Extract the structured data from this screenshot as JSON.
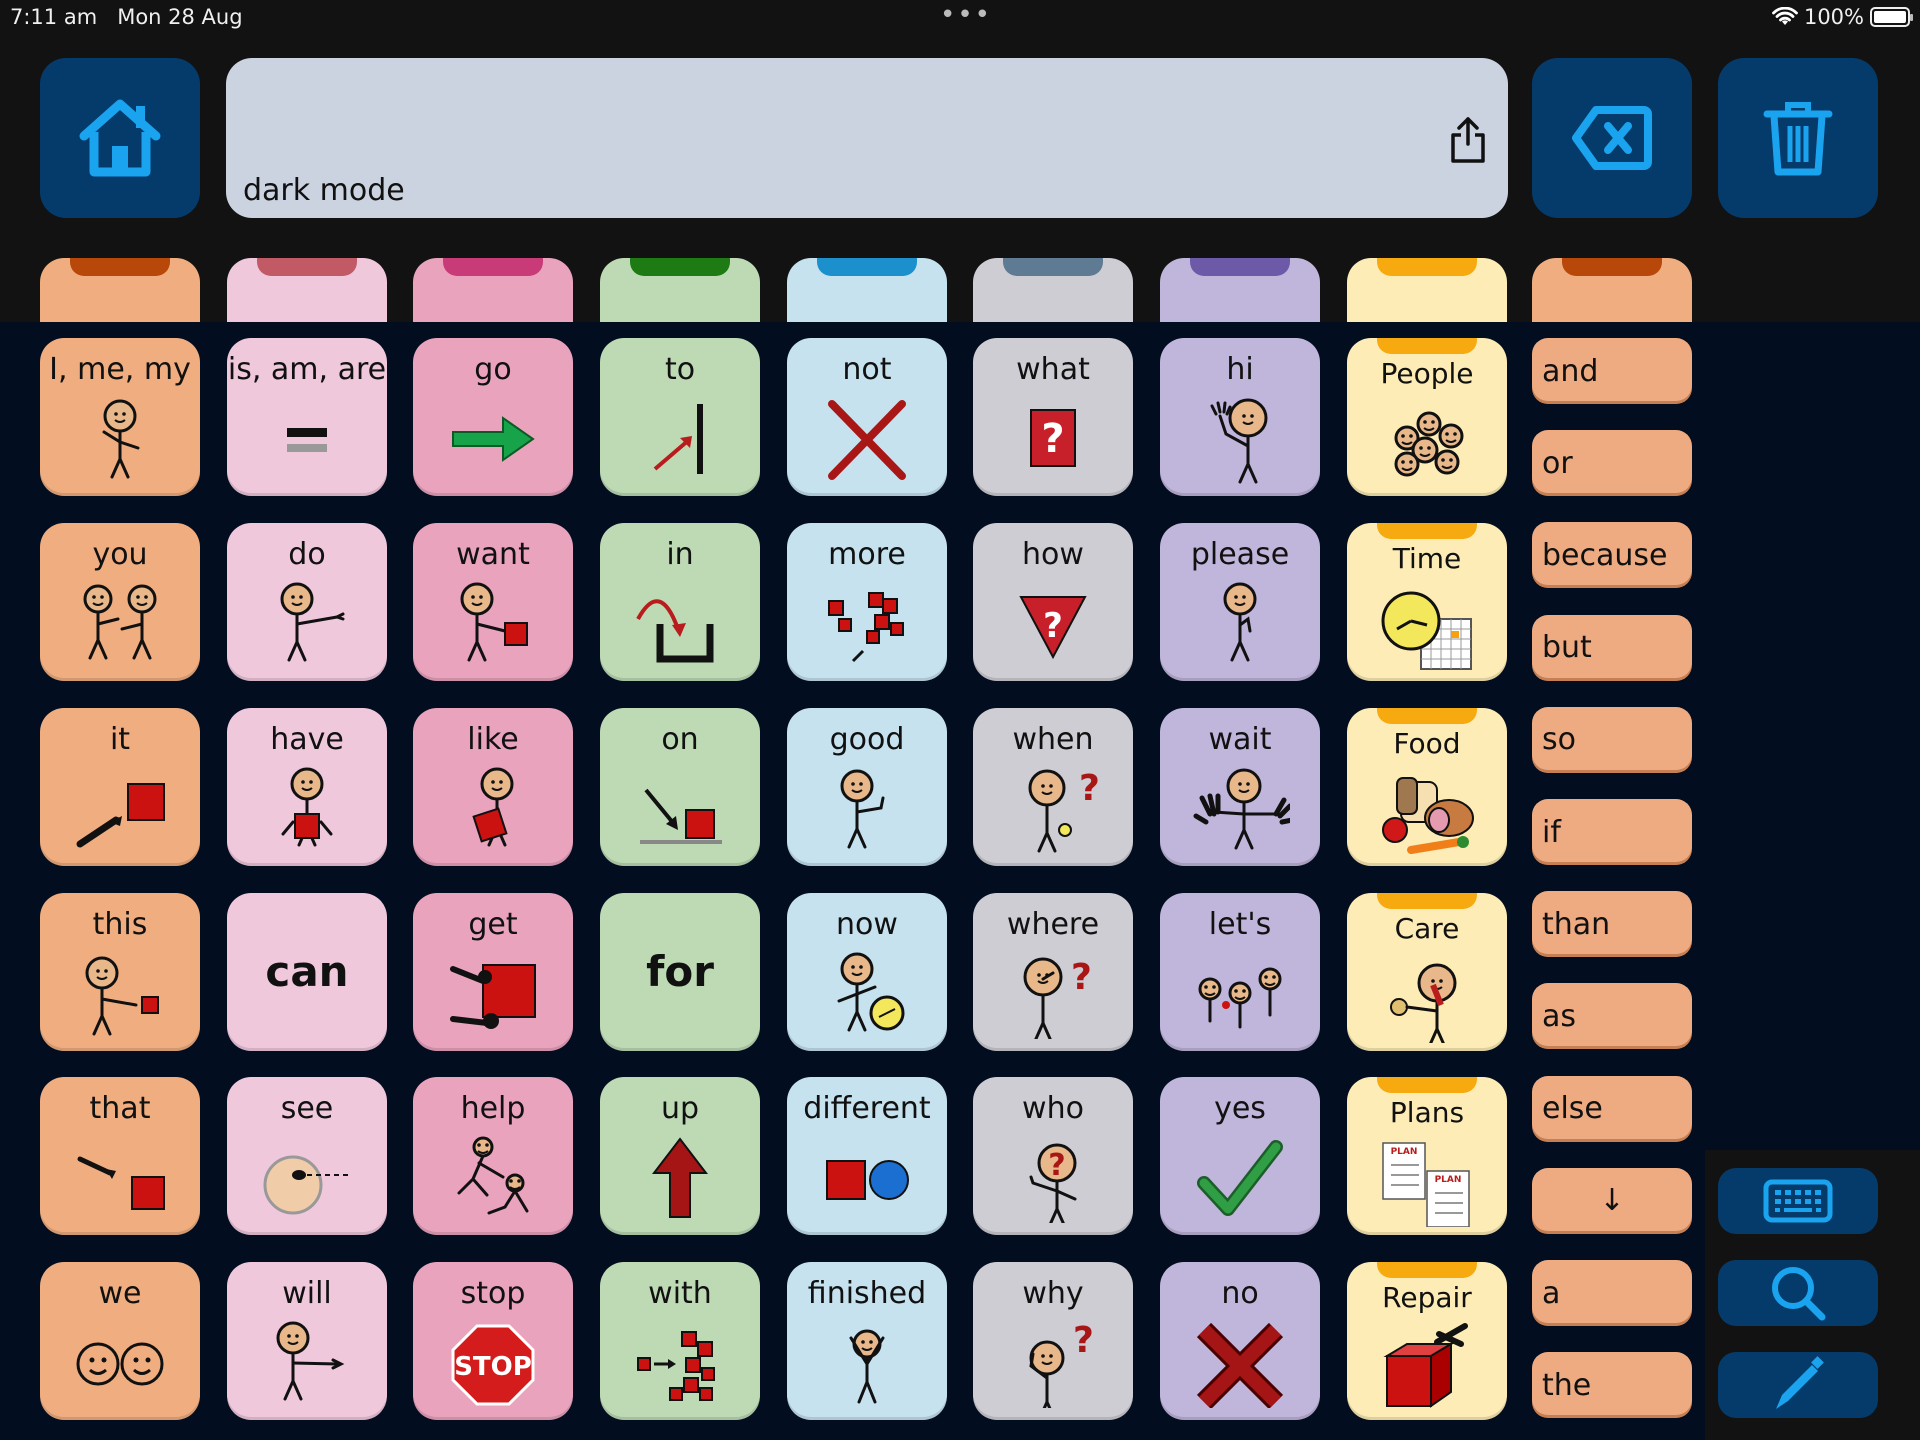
{
  "status_bar": {
    "time": "7:11 am",
    "date": "Mon 28 Aug",
    "battery_percent": "100%",
    "battery_level": 1.0
  },
  "toolbar": {
    "home_icon": "home-icon",
    "message_text": "dark mode",
    "share_icon": "share-icon",
    "backspace_icon": "backspace-icon",
    "clear_icon": "trash-icon"
  },
  "colors": {
    "accent_icon": "#1aa3ef",
    "toolbar_button": "#053b6b",
    "grid_background": "#020d1f",
    "orange": "#efad80",
    "orange_notch": "#b8470a",
    "pink_light": "#f0c8dc",
    "pink_light_notch": "#c25a66",
    "pink": "#e9a3bd",
    "pink_notch": "#c93b78",
    "green": "#bddab4",
    "green_notch": "#1e7a12",
    "blue": "#c5e2ee",
    "blue_notch": "#1b90cc",
    "gray": "#cdcdd3",
    "gray_notch": "#5f7a93",
    "purple": "#c0b5da",
    "purple_notch": "#6c5aa8",
    "yellow": "#fdecb6",
    "yellow_notch": "#f7aa0f"
  },
  "tabs": [
    "orange",
    "pink_light",
    "pink",
    "green",
    "blue",
    "gray",
    "purple",
    "yellow",
    "orange"
  ],
  "grid": {
    "rows": [
      [
        {
          "label": "I, me, my",
          "color": "orange",
          "symbol": "person-pointing-self"
        },
        {
          "label": "is, am, are",
          "color": "pink_light",
          "symbol": "equals"
        },
        {
          "label": "go",
          "color": "pink",
          "symbol": "green-arrow-right"
        },
        {
          "label": "to",
          "color": "green",
          "symbol": "arrow-to-line"
        },
        {
          "label": "not",
          "color": "blue",
          "symbol": "red-cross"
        },
        {
          "label": "what",
          "color": "gray",
          "symbol": "question-box"
        },
        {
          "label": "hi",
          "color": "purple",
          "symbol": "person-waving"
        },
        {
          "label": "People",
          "color": "yellow",
          "symbol": "group-faces",
          "folder": true
        }
      ],
      [
        {
          "label": "you",
          "color": "orange",
          "symbol": "two-people-pointing"
        },
        {
          "label": "do",
          "color": "pink_light",
          "symbol": "person-doing"
        },
        {
          "label": "want",
          "color": "pink",
          "symbol": "person-reaching-box"
        },
        {
          "label": "in",
          "color": "green",
          "symbol": "arrow-into-container"
        },
        {
          "label": "more",
          "color": "blue",
          "symbol": "pile-of-squares"
        },
        {
          "label": "how",
          "color": "gray",
          "symbol": "question-triangle"
        },
        {
          "label": "please",
          "color": "purple",
          "symbol": "person-please"
        },
        {
          "label": "Time",
          "color": "yellow",
          "symbol": "clock-calendar",
          "folder": true
        }
      ],
      [
        {
          "label": "it",
          "color": "orange",
          "symbol": "hand-pointing-box"
        },
        {
          "label": "have",
          "color": "pink_light",
          "symbol": "person-holding-box"
        },
        {
          "label": "like",
          "color": "pink",
          "symbol": "person-hugging-box"
        },
        {
          "label": "on",
          "color": "green",
          "symbol": "arrow-onto-surface"
        },
        {
          "label": "good",
          "color": "blue",
          "symbol": "person-thumbs-up"
        },
        {
          "label": "when",
          "color": "gray",
          "symbol": "person-watch-question"
        },
        {
          "label": "wait",
          "color": "purple",
          "symbol": "person-hands-up"
        },
        {
          "label": "Food",
          "color": "yellow",
          "symbol": "food-items",
          "folder": true
        }
      ],
      [
        {
          "label": "this",
          "color": "orange",
          "symbol": "person-pointing-near"
        },
        {
          "label": "can",
          "color": "pink_light",
          "symbol": null,
          "big": true
        },
        {
          "label": "get",
          "color": "pink",
          "symbol": "hands-grabbing-box"
        },
        {
          "label": "for",
          "color": "green",
          "symbol": null,
          "big": true
        },
        {
          "label": "now",
          "color": "blue",
          "symbol": "person-clock"
        },
        {
          "label": "where",
          "color": "gray",
          "symbol": "person-looking-question"
        },
        {
          "label": "let's",
          "color": "purple",
          "symbol": "group-people"
        },
        {
          "label": "Care",
          "color": "yellow",
          "symbol": "person-care",
          "folder": true
        }
      ],
      [
        {
          "label": "that",
          "color": "orange",
          "symbol": "hand-pointing-far"
        },
        {
          "label": "see",
          "color": "pink_light",
          "symbol": "eye-looking"
        },
        {
          "label": "help",
          "color": "pink",
          "symbol": "person-helping"
        },
        {
          "label": "up",
          "color": "green",
          "symbol": "red-arrow-up"
        },
        {
          "label": "different",
          "color": "blue",
          "symbol": "square-and-circle"
        },
        {
          "label": "who",
          "color": "gray",
          "symbol": "person-question-face"
        },
        {
          "label": "yes",
          "color": "purple",
          "symbol": "green-check"
        },
        {
          "label": "Plans",
          "color": "yellow",
          "symbol": "plan-sheets",
          "folder": true
        }
      ],
      [
        {
          "label": "we",
          "color": "orange",
          "symbol": "two-faces"
        },
        {
          "label": "will",
          "color": "pink_light",
          "symbol": "person-pointing-forward"
        },
        {
          "label": "stop",
          "color": "pink",
          "symbol": "stop-sign"
        },
        {
          "label": "with",
          "color": "green",
          "symbol": "squares-joining"
        },
        {
          "label": "finished",
          "color": "blue",
          "symbol": "person-arms-up"
        },
        {
          "label": "why",
          "color": "gray",
          "symbol": "person-thinking-question"
        },
        {
          "label": "no",
          "color": "purple",
          "symbol": "red-x"
        },
        {
          "label": "Repair",
          "color": "yellow",
          "symbol": "broken-box-tape",
          "folder": true
        }
      ]
    ]
  },
  "side_words": [
    "and",
    "or",
    "because",
    "but",
    "so",
    "if",
    "than",
    "as",
    "else",
    "↓",
    "a",
    "the"
  ],
  "tools": [
    {
      "name": "keyboard-button",
      "icon": "keyboard-icon"
    },
    {
      "name": "search-button",
      "icon": "search-icon"
    },
    {
      "name": "edit-button",
      "icon": "pencil-icon"
    }
  ]
}
